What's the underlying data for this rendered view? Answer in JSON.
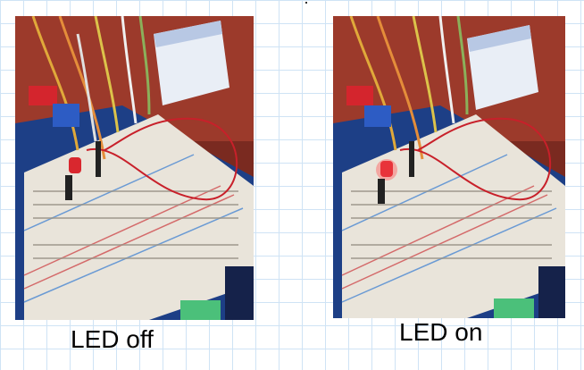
{
  "panels": [
    {
      "caption": "LED off",
      "led_color": "#d9272e",
      "led_state": "off"
    },
    {
      "caption": "LED on",
      "led_color": "#e8333a",
      "led_state": "on"
    }
  ],
  "colors": {
    "grid": "#cfe3f5",
    "board_blue": "#1d3f86",
    "breadboard": "#e9e4da",
    "jumper_red": "#c8202a",
    "background_red": "#8a2e22"
  }
}
